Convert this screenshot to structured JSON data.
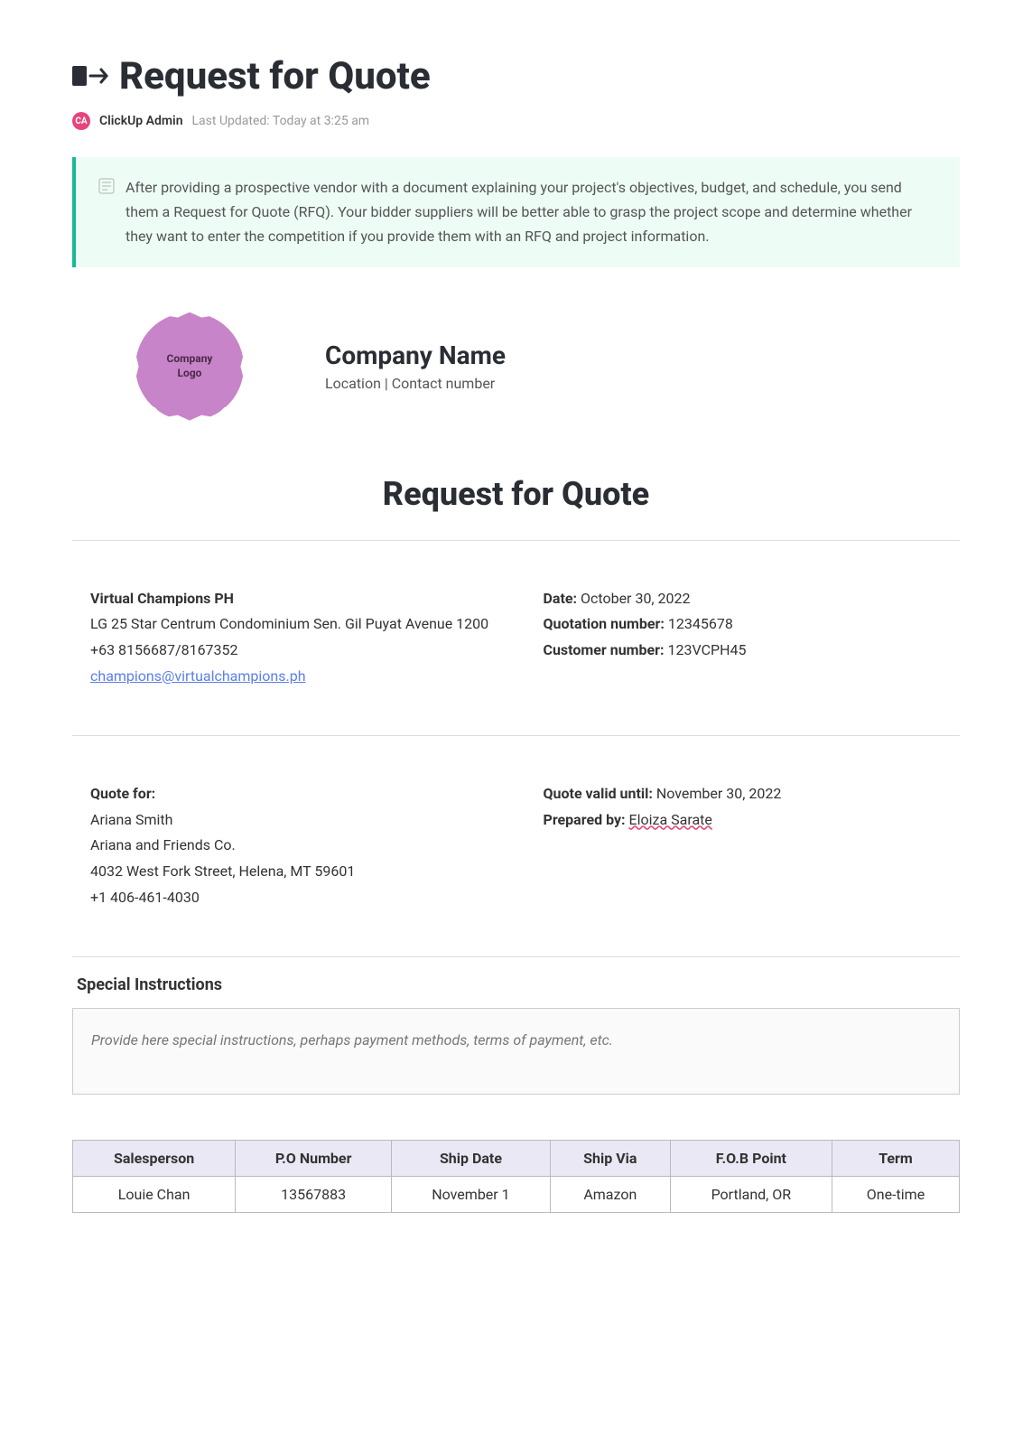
{
  "header": {
    "title": "Request for Quote",
    "avatar_initials": "CA",
    "author": "ClickUp Admin",
    "updated": "Last Updated: Today at 3:25 am"
  },
  "info_box": {
    "text": "After providing a prospective vendor with a document explaining your project's objectives, budget, and schedule, you send them a Request for Quote (RFQ). Your bidder suppliers will be better able to grasp the project scope and determine whether they want to enter the competition if you provide them with an RFQ and project information."
  },
  "company": {
    "logo_line1": "Company",
    "logo_line2": "Logo",
    "name": "Company Name",
    "location": "Location | Contact number"
  },
  "doc_title": "Request for Quote",
  "vendor": {
    "name": "Virtual Champions PH",
    "address1": "LG 25 Star Centrum Condominium Sen. Gil Puyat Avenue 1200",
    "phone": "+63 8156687/8167352",
    "email": "champions@virtualchampions.ph"
  },
  "quote_meta": {
    "date_label": "Date:",
    "date": "October 30, 2022",
    "qnum_label": "Quotation number:",
    "qnum": "12345678",
    "cnum_label": "Customer number:",
    "cnum": "123VCPH45"
  },
  "quote_for": {
    "label": "Quote for:",
    "name": "Ariana Smith",
    "company": "Ariana and Friends Co.",
    "address": "4032 West Fork Street, Helena, MT 59601",
    "phone": "+1 406-461-4030"
  },
  "quote_validity": {
    "valid_label": "Quote valid until:",
    "valid": "November 30, 2022",
    "prepared_label": "Prepared by:",
    "prepared": "Eloiza Sarate"
  },
  "special": {
    "heading": "Special Instructions",
    "placeholder": "Provide here special instructions, perhaps payment methods, terms of payment, etc."
  },
  "table": {
    "headers": {
      "salesperson": "Salesperson",
      "po": "P.O Number",
      "shipdate": "Ship Date",
      "shipvia": "Ship Via",
      "fob": "F.O.B Point",
      "term": "Term"
    },
    "row": {
      "salesperson": "Louie Chan",
      "po": "13567883",
      "shipdate": "November 1",
      "shipvia": "Amazon",
      "fob": "Portland, OR",
      "term": "One-time"
    }
  }
}
